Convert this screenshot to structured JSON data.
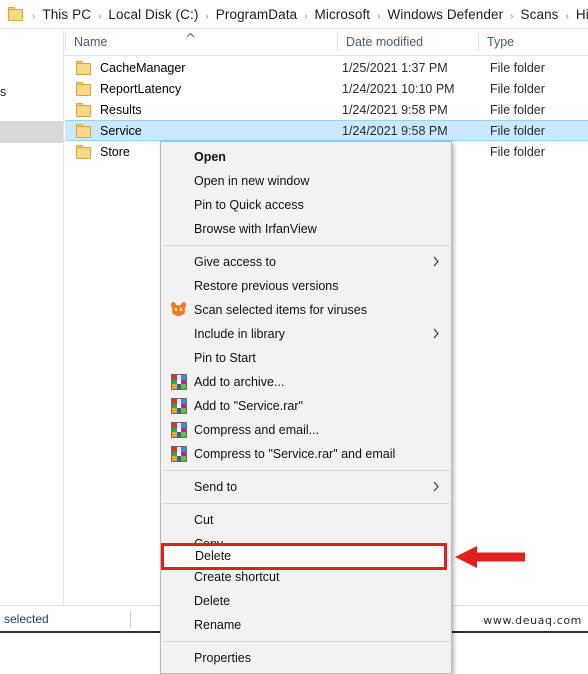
{
  "window": {
    "app": "File Explorer"
  },
  "addressbar": {
    "folder_icon": "folder-icon",
    "separator": "›",
    "crumbs": [
      "This PC",
      "Local Disk (C:)",
      "ProgramData",
      "Microsoft",
      "Windows Defender",
      "Scans",
      "History"
    ]
  },
  "columns": {
    "name": "Name",
    "date_modified": "Date modified",
    "type": "Type",
    "sort_indicator": "˄"
  },
  "navpane": {
    "partial_label": "s"
  },
  "files": [
    {
      "name": "CacheManager",
      "date": "1/25/2021 1:37 PM",
      "type": "File folder",
      "selected": false
    },
    {
      "name": "ReportLatency",
      "date": "1/24/2021 10:10 PM",
      "type": "File folder",
      "selected": false
    },
    {
      "name": "Results",
      "date": "1/24/2021 9:58 PM",
      "type": "File folder",
      "selected": false
    },
    {
      "name": "Service",
      "date": "1/24/2021 9:58 PM",
      "type": "File folder",
      "selected": true
    },
    {
      "name": "Store",
      "date": "",
      "type": "File folder",
      "selected": false
    }
  ],
  "context_menu": {
    "items": [
      {
        "label": "Open",
        "icon": "none",
        "bold": true,
        "submenu": false,
        "separator_after": false
      },
      {
        "label": "Open in new window",
        "icon": "none",
        "bold": false,
        "submenu": false,
        "separator_after": false
      },
      {
        "label": "Pin to Quick access",
        "icon": "none",
        "bold": false,
        "submenu": false,
        "separator_after": false
      },
      {
        "label": "Browse with IrfanView",
        "icon": "none",
        "bold": false,
        "submenu": false,
        "separator_after": true
      },
      {
        "label": "Give access to",
        "icon": "none",
        "bold": false,
        "submenu": true,
        "separator_after": false
      },
      {
        "label": "Restore previous versions",
        "icon": "none",
        "bold": false,
        "submenu": false,
        "separator_after": false
      },
      {
        "label": "Scan selected items for viruses",
        "icon": "avast",
        "bold": false,
        "submenu": false,
        "separator_after": false
      },
      {
        "label": "Include in library",
        "icon": "none",
        "bold": false,
        "submenu": true,
        "separator_after": false
      },
      {
        "label": "Pin to Start",
        "icon": "none",
        "bold": false,
        "submenu": false,
        "separator_after": false
      },
      {
        "label": "Add to archive...",
        "icon": "winrar",
        "bold": false,
        "submenu": false,
        "separator_after": false
      },
      {
        "label": "Add to \"Service.rar\"",
        "icon": "winrar",
        "bold": false,
        "submenu": false,
        "separator_after": false
      },
      {
        "label": "Compress and email...",
        "icon": "winrar",
        "bold": false,
        "submenu": false,
        "separator_after": false
      },
      {
        "label": "Compress to \"Service.rar\" and email",
        "icon": "winrar",
        "bold": false,
        "submenu": false,
        "separator_after": true
      },
      {
        "label": "Send to",
        "icon": "none",
        "bold": false,
        "submenu": true,
        "separator_after": true
      },
      {
        "label": "Cut",
        "icon": "none",
        "bold": false,
        "submenu": false,
        "separator_after": false
      },
      {
        "label": "Copy",
        "icon": "none",
        "bold": false,
        "submenu": false,
        "separator_after": true
      },
      {
        "label": "Create shortcut",
        "icon": "none",
        "bold": false,
        "submenu": false,
        "separator_after": false
      },
      {
        "label": "Delete",
        "icon": "none",
        "bold": false,
        "submenu": false,
        "separator_after": false
      },
      {
        "label": "Rename",
        "icon": "none",
        "bold": false,
        "submenu": false,
        "separator_after": true
      },
      {
        "label": "Properties",
        "icon": "none",
        "bold": false,
        "submenu": false,
        "separator_after": false
      }
    ]
  },
  "annotation": {
    "highlight_target": "Delete",
    "highlight_color": "#e01f1f",
    "arrow": "left-arrow",
    "arrow_color": "#e01f1f"
  },
  "statusbar": {
    "text": "selected"
  },
  "watermark": {
    "text": "www.deuaq.com"
  }
}
